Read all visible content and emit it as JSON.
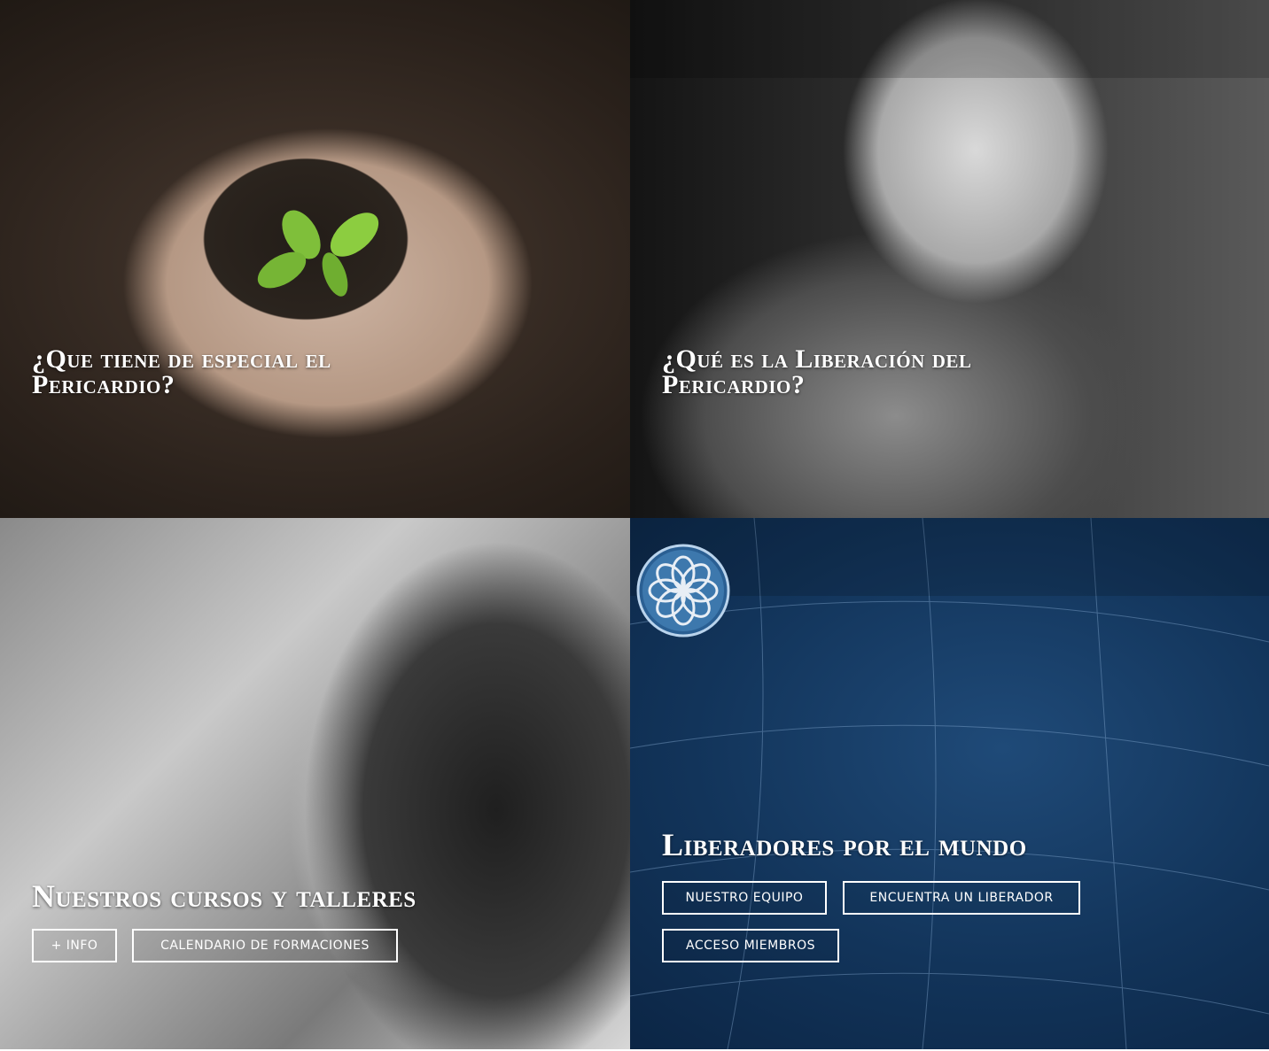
{
  "tiles": {
    "especial": {
      "title": "¿Que tiene de especial el Pericardio?",
      "image": "hands-holding-heart-soil-sprout"
    },
    "liberacion": {
      "title": "¿Qué es la Liberación del Pericardio?",
      "image": "baby-portrait-bw"
    },
    "cursos": {
      "title": "Nuestros cursos y talleres",
      "image": "woman-profile-bw",
      "buttons": {
        "info": "+ INFO",
        "calendario": "CALENDARIO DE FORMACIONES"
      }
    },
    "liberadores": {
      "title": "Liberadores por el mundo",
      "image": "world-map-globe",
      "logo": "globe-flower-logo",
      "buttons": {
        "equipo": "NUESTRO EQUIPO",
        "encuentra": "ENCUENTRA UN LIBERADOR",
        "acceso": "ACCESO MIEMBROS"
      }
    }
  },
  "colors": {
    "text": "#ffffff",
    "globe_blue": "#12345a"
  }
}
